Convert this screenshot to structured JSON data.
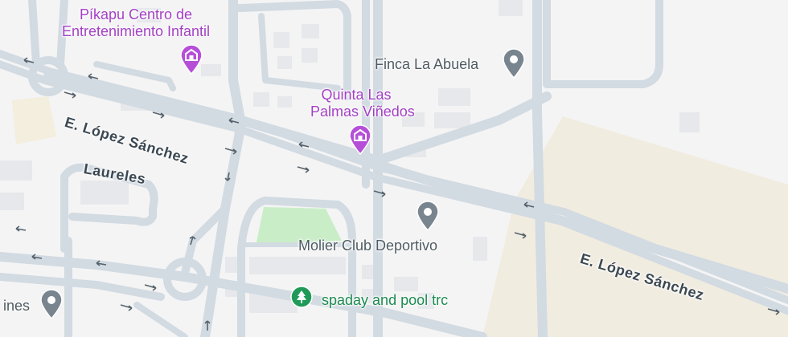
{
  "map": {
    "colors": {
      "background": "#f4f4f4",
      "road": "#cdd6df",
      "road_fill": "#d4dce4",
      "building": "#e8eaed",
      "park": "#c9eec7",
      "sand": "#f1ece0",
      "poi_purple": "#a33fc4",
      "poi_gray": "#78858f",
      "poi_green": "#1b8a4f"
    },
    "streets": [
      {
        "label": "E. López Sánchez",
        "id": "street-lopez-sanchez-west"
      },
      {
        "label": "E. López Sánchez",
        "id": "street-lopez-sanchez-east"
      },
      {
        "label": "Laureles",
        "id": "street-laureles"
      }
    ],
    "places": {
      "pikapu": {
        "line1": "Píkapu Centro de",
        "line2": "Entretenimiento Infantil",
        "icon": "amusement-park-icon"
      },
      "quinta": {
        "line1": "Quinta Las",
        "line2": "Palmas Viñedos",
        "icon": "amusement-park-icon"
      },
      "finca": {
        "label": "Finca La Abuela",
        "icon": "place-pin-icon"
      },
      "molier": {
        "label": "Molier Club Deportivo",
        "icon": "place-pin-icon"
      },
      "spaday": {
        "label": "spaday and pool trc",
        "icon": "tree-icon"
      },
      "partial": {
        "label": "ines",
        "icon": "place-pin-icon"
      }
    }
  }
}
